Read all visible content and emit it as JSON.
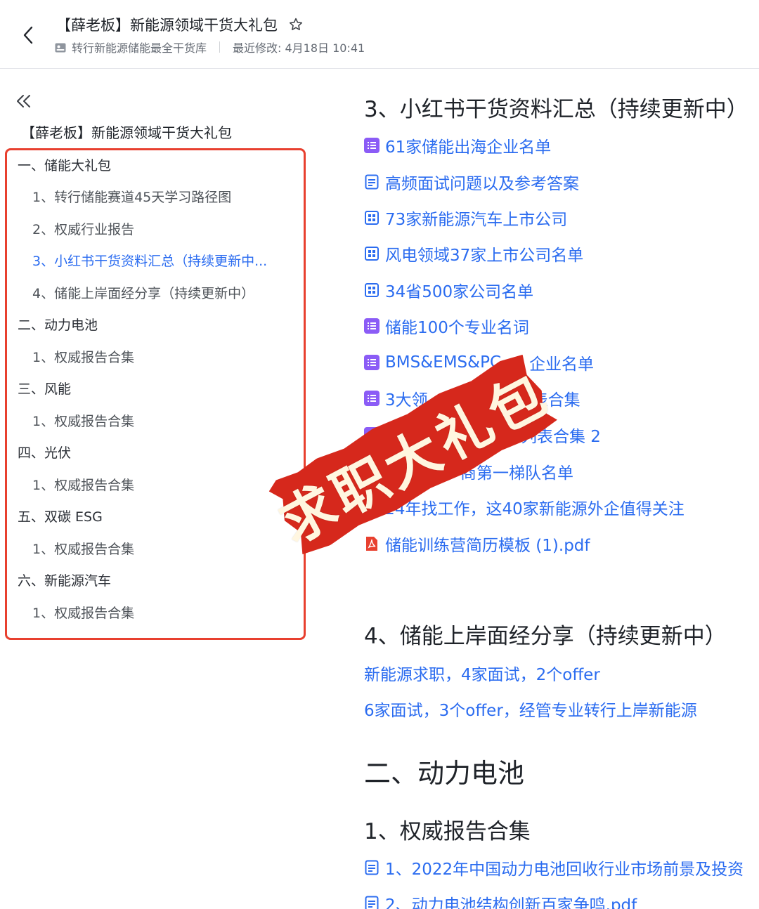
{
  "header": {
    "title": "【薛老板】新能源领域干货大礼包",
    "wiki_name": "转行新能源储能最全干货库",
    "last_modified_label": "最近修改: 4月18日 10:41"
  },
  "sidebar": {
    "toc_title": "【薛老板】新能源领域干货大礼包",
    "items": [
      {
        "label": "一、储能大礼包"
      },
      {
        "label": "1、转行储能赛道45天学习路径图"
      },
      {
        "label": "2、权威行业报告"
      },
      {
        "label": "3、小红书干货资料汇总（持续更新中..."
      },
      {
        "label": "4、储能上岸面经分享（持续更新中）"
      },
      {
        "label": "二、动力电池"
      },
      {
        "label": "1、权威报告合集"
      },
      {
        "label": "三、风能"
      },
      {
        "label": "1、权威报告合集"
      },
      {
        "label": "四、光伏"
      },
      {
        "label": "1、权威报告合集"
      },
      {
        "label": "五、双碳 ESG"
      },
      {
        "label": "1、权威报告合集"
      },
      {
        "label": "六、新能源汽车"
      },
      {
        "label": "1、权威报告合集"
      }
    ]
  },
  "main": {
    "section3_title": "3、小红书干货资料汇总（持续更新中）",
    "section3_links": [
      {
        "label": "61家储能出海企业名单",
        "icon": "list-icon"
      },
      {
        "label": "高频面试问题以及参考答案",
        "icon": "doc-icon"
      },
      {
        "label": "73家新能源汽车上市公司",
        "icon": "table-icon"
      },
      {
        "label": "风电领域37家上市公司名单",
        "icon": "table-icon"
      },
      {
        "label": "34省500家公司名单",
        "icon": "table-icon"
      },
      {
        "label": "储能100个专业名词",
        "icon": "list-icon"
      },
      {
        "label": "BMS&EMS&PC",
        "icon": "list-icon",
        "suffix": "企业名单"
      },
      {
        "label": "3大领",
        "icon": "list-icon",
        "suffix": "表合集"
      },
      {
        "label": "",
        "icon": "list-icon",
        "suffix": "池公司列表合集 2"
      },
      {
        "label": "",
        "icon": "none",
        "suffix": "储能厂商第一梯队名单"
      },
      {
        "label": "2024年找工作，这40家新能源外企值得关注",
        "icon": "none"
      },
      {
        "label": "储能训练营简历模板 (1).pdf",
        "icon": "pdf-icon"
      }
    ],
    "section4_title": "4、储能上岸面经分享（持续更新中）",
    "section4_links": [
      {
        "label": "新能源求职，4家面试，2个offer"
      },
      {
        "label": "6家面试，3个offer，经管专业转行上岸新能源"
      }
    ],
    "part2_title": "二、动力电池",
    "part2_sub_title": "1、权威报告合集",
    "part2_links": [
      {
        "label": "1、2022年中国动力电池回收行业市场前景及投资",
        "icon": "doc-icon"
      },
      {
        "label": "2、动力电池结构创新百家争鸣.pdf",
        "icon": "doc-icon"
      }
    ]
  },
  "stamp": {
    "text": "求职大礼包",
    "color": "#d6281c"
  },
  "colors": {
    "link": "#2b6cf0",
    "toc_highlight_border": "#e8402f",
    "list_icon": "#8b5cf6"
  }
}
